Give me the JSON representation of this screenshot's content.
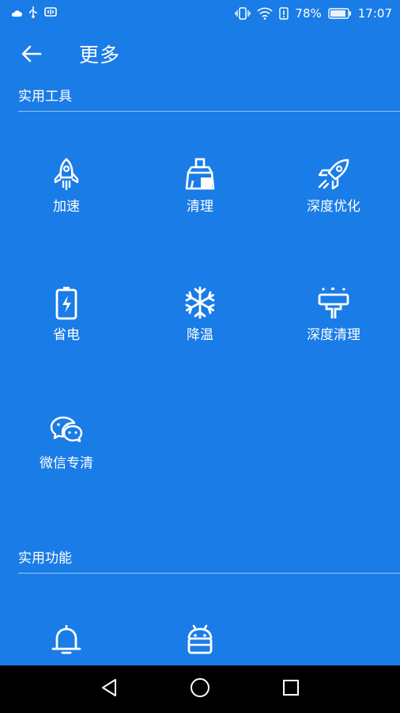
{
  "status_bar": {
    "battery_percent": "78%",
    "time": "17:07",
    "icons": [
      "cloud-icon",
      "usb-icon",
      "notification-app-icon",
      "vibrate-icon",
      "wifi-icon",
      "sim-alert-icon",
      "battery-icon"
    ]
  },
  "header": {
    "title": "更多",
    "back_icon": "arrow-left-icon"
  },
  "sections": [
    {
      "title": "实用工具",
      "tools": [
        {
          "label": "加速",
          "icon": "rocket-icon"
        },
        {
          "label": "清理",
          "icon": "broom-icon"
        },
        {
          "label": "深度优化",
          "icon": "rocket-launch-icon"
        },
        {
          "label": "省电",
          "icon": "battery-charge-icon"
        },
        {
          "label": "降温",
          "icon": "snowflake-icon"
        },
        {
          "label": "深度清理",
          "icon": "deep-clean-icon"
        },
        {
          "label": "微信专清",
          "icon": "wechat-icon"
        }
      ]
    },
    {
      "title": "实用功能",
      "tools": [
        {
          "label": "",
          "icon": "bell-icon"
        },
        {
          "label": "",
          "icon": "android-icon"
        }
      ]
    }
  ],
  "nav_bar": {
    "buttons": [
      "back-triangle-icon",
      "home-circle-icon",
      "recents-square-icon"
    ]
  }
}
